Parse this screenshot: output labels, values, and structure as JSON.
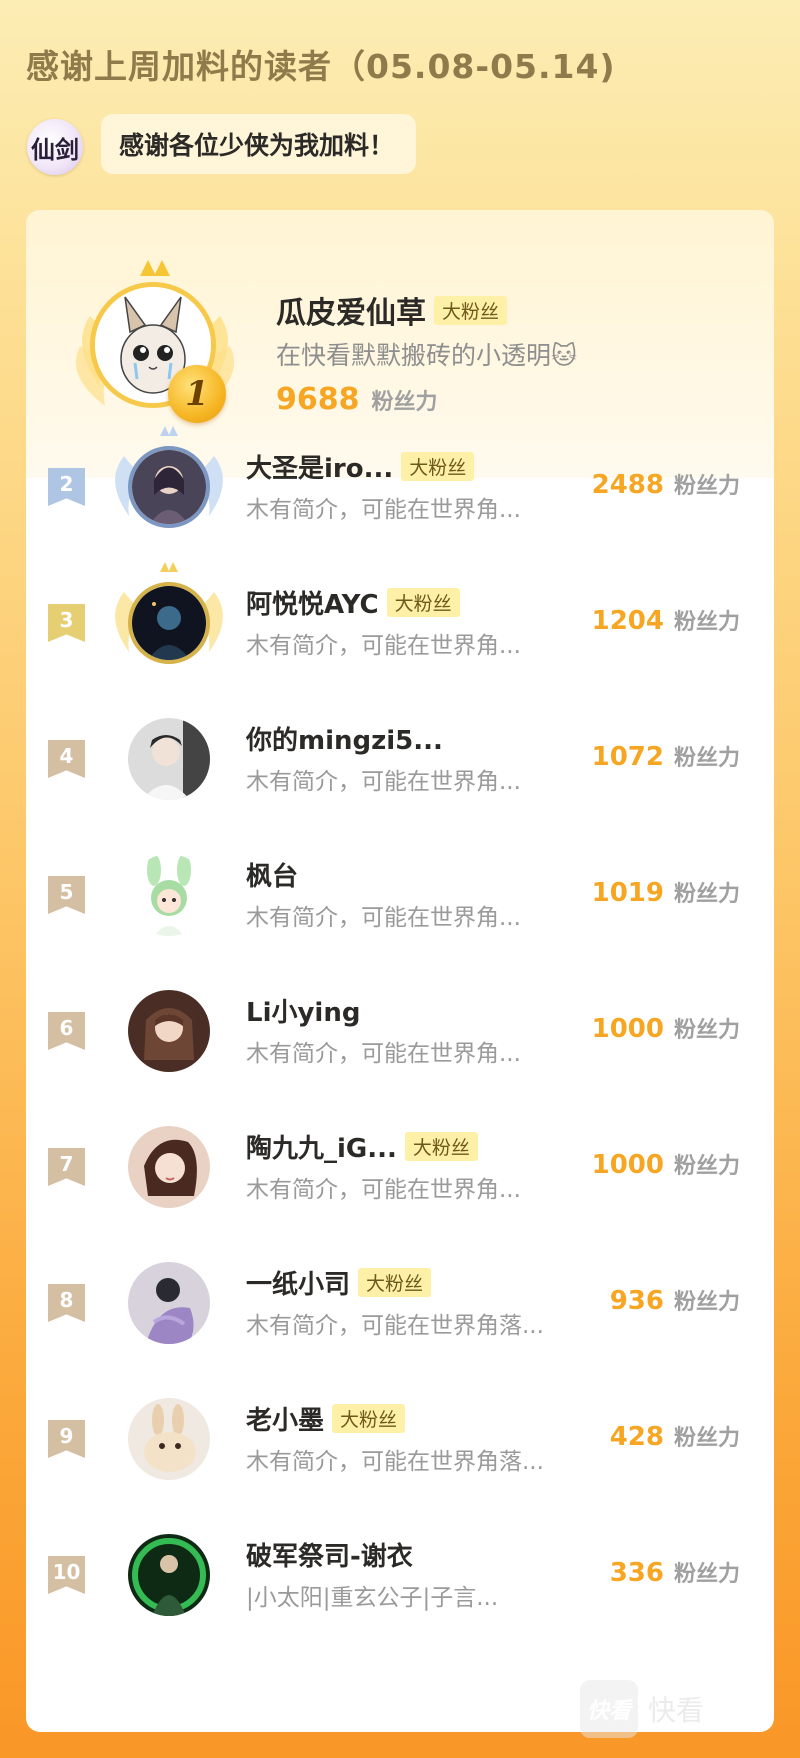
{
  "header": {
    "title": "感谢上周加料的读者（05.08-05.14)",
    "brand_logo_text": "仙剑",
    "bubble_text": "感谢各位少侠为我加料！"
  },
  "top_reader": {
    "rank": "1",
    "name": "瓜皮爱仙草",
    "badge": "大粉丝",
    "bio": "在快看默默搬砖的小透明🐱",
    "power_value": "9688",
    "power_unit": "粉丝力"
  },
  "readers": [
    {
      "rank": "2",
      "name": "大圣是iro...",
      "badge": "大粉丝",
      "bio": "木有简介，可能在世界角...",
      "power_value": "2488",
      "power_unit": "粉丝力"
    },
    {
      "rank": "3",
      "name": "阿悦悦AYC",
      "badge": "大粉丝",
      "bio": "木有简介，可能在世界角...",
      "power_value": "1204",
      "power_unit": "粉丝力"
    },
    {
      "rank": "4",
      "name": "你的mingzi5...",
      "badge": "",
      "bio": "木有简介，可能在世界角...",
      "power_value": "1072",
      "power_unit": "粉丝力"
    },
    {
      "rank": "5",
      "name": "枫台",
      "badge": "",
      "bio": "木有简介，可能在世界角...",
      "power_value": "1019",
      "power_unit": "粉丝力"
    },
    {
      "rank": "6",
      "name": "Li小ying",
      "badge": "",
      "bio": "木有简介，可能在世界角...",
      "power_value": "1000",
      "power_unit": "粉丝力"
    },
    {
      "rank": "7",
      "name": "陶九九_iG...",
      "badge": "大粉丝",
      "bio": "木有简介，可能在世界角...",
      "power_value": "1000",
      "power_unit": "粉丝力"
    },
    {
      "rank": "8",
      "name": "一纸小司",
      "badge": "大粉丝",
      "bio": "木有简介，可能在世界角落...",
      "power_value": "936",
      "power_unit": "粉丝力"
    },
    {
      "rank": "9",
      "name": "老小墨",
      "badge": "大粉丝",
      "bio": "木有简介，可能在世界角落...",
      "power_value": "428",
      "power_unit": "粉丝力"
    },
    {
      "rank": "10",
      "name": "破军祭司-谢衣",
      "badge": "",
      "bio": "|小太阳|重玄公子|子言...",
      "power_value": "336",
      "power_unit": "粉丝力"
    }
  ],
  "watermark": {
    "logo_text": "快看",
    "text": "快看"
  },
  "colors": {
    "accent_orange": "#f6a623",
    "badge_bg": "#fff0a8",
    "rank2_tag": "#aec5e3",
    "rank3_tag": "#e6cf72",
    "rank_other_tag": "#d5bfa3"
  }
}
